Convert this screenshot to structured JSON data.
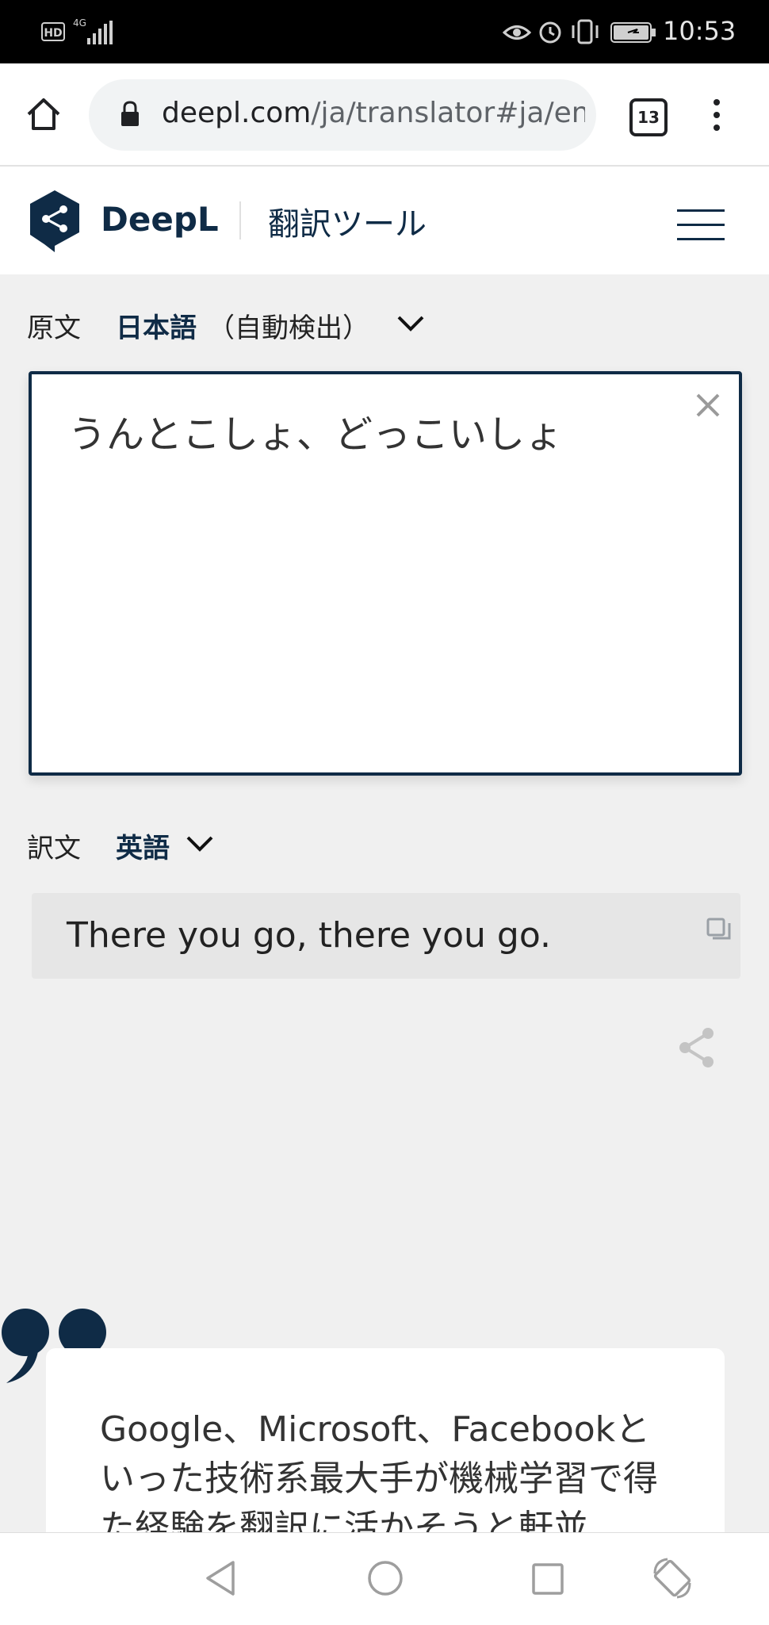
{
  "status_bar": {
    "hd_badge": "HD",
    "network": "4G",
    "time": "10:53"
  },
  "browser": {
    "url_domain": "deepl.com",
    "url_path": "/ja/translator#ja/en/",
    "tab_count": "13"
  },
  "site": {
    "brand": "DeepL",
    "subtitle": "翻訳ツール"
  },
  "source": {
    "label": "原文",
    "language": "日本語",
    "auto_detect": "（自動検出）",
    "text": "うんとこしょ、どっこいしょ"
  },
  "target": {
    "label": "訳文",
    "language": "英語",
    "text": "There you go, there you go."
  },
  "quote": {
    "text": "Google、Microsoft、Facebookといった技術系最大手が機械学習で得た経験を翻訳に活かそうと軒並"
  },
  "colors": {
    "brand_navy": "#0f2b46",
    "page_bg": "#f0f0f0"
  }
}
